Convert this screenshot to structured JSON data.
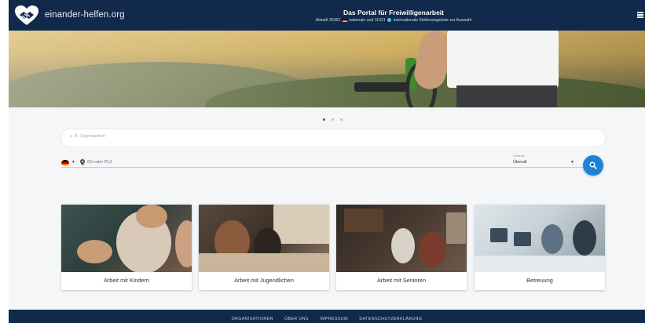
{
  "header": {
    "brand": "einander-helfen.org",
    "portal_title": "Das Portal für Freiwilligenarbeit",
    "sub_prefix": "Aktuell",
    "national_count": "35352",
    "national_label": "nationale und",
    "international_count": "11021",
    "international_label": "internationale Stellenangebote zur Auswahl"
  },
  "search": {
    "placeholder": "z. B. Jugendarbeit",
    "location_placeholder": "Ort oder PLZ",
    "radius_label": "Umkreis",
    "radius_value": "Überall"
  },
  "carousel": {
    "slide_count": 3,
    "active_slide": 1
  },
  "categories": [
    {
      "label": "Arbeit mit Kindern"
    },
    {
      "label": "Arbeit mit Jugendlichen"
    },
    {
      "label": "Arbeit mit Senioren"
    },
    {
      "label": "Betreuung"
    }
  ],
  "footer": {
    "links": [
      "ORGANISATIONEN",
      "ÜBER UNS",
      "IMPRESSUM",
      "DATENSCHUTZERKLÄRUNG"
    ]
  },
  "colors": {
    "header_bg": "#11294b",
    "accent": "#1c82d8",
    "page_bg": "#f5f6f8"
  }
}
